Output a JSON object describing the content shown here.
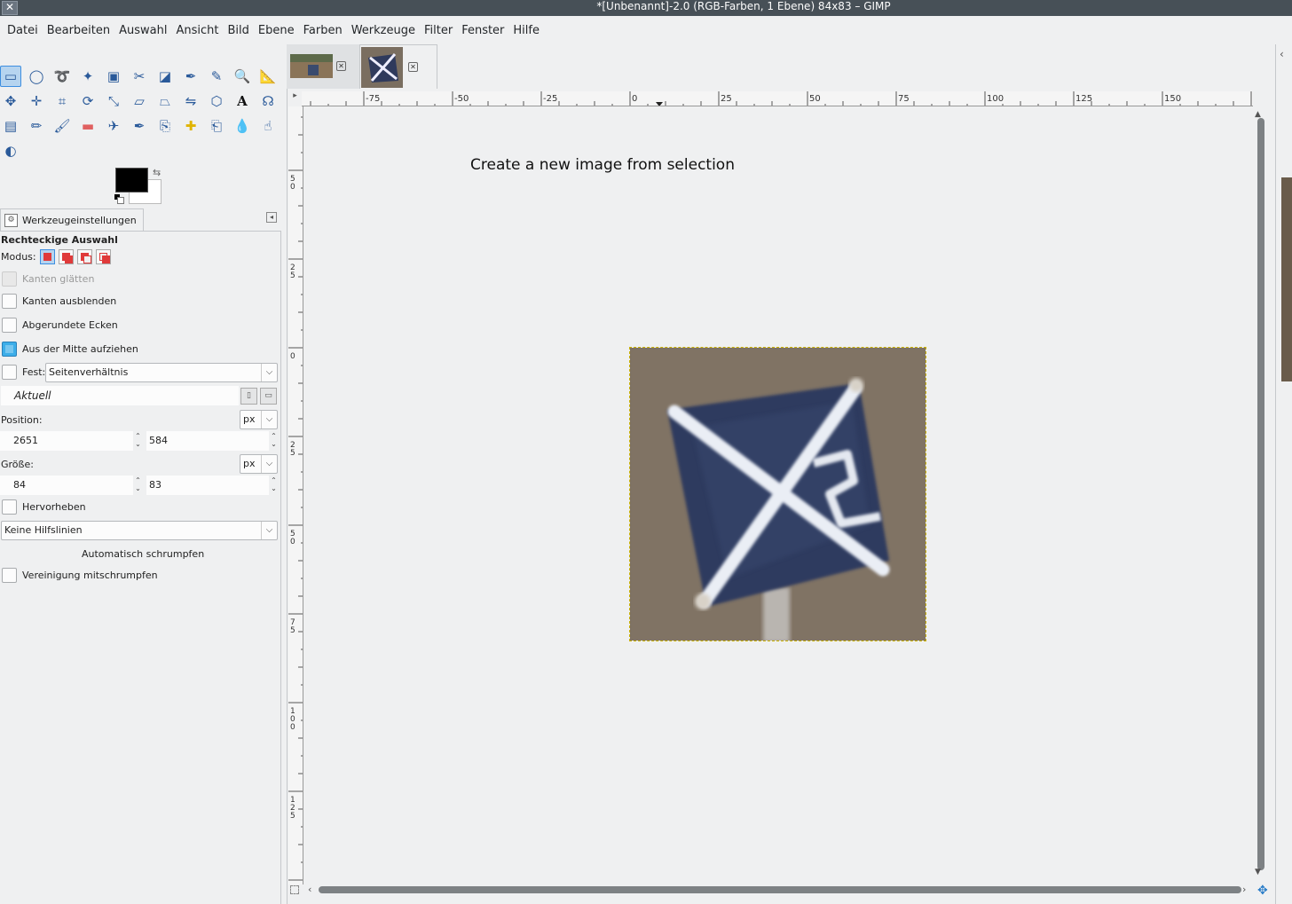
{
  "window": {
    "title": "*[Unbenannt]-2.0 (RGB-Farben, 1 Ebene) 84x83 – GIMP"
  },
  "menubar": {
    "items": [
      "Datei",
      "Bearbeiten",
      "Auswahl",
      "Ansicht",
      "Bild",
      "Ebene",
      "Farben",
      "Werkzeuge",
      "Filter",
      "Fenster",
      "Hilfe"
    ]
  },
  "toolbox": {
    "tools": [
      "rect-select",
      "ellipse-select",
      "free-select",
      "fuzzy-select",
      "select-by-color",
      "scissors-select",
      "foreground-select",
      "paths",
      "color-picker",
      "zoom",
      "measure",
      "move",
      "align",
      "crop",
      "rotate",
      "scale",
      "shear",
      "perspective",
      "flip",
      "cage-transform",
      "text",
      "warp-transform",
      "blend",
      "pencil",
      "paintbrush",
      "eraser",
      "airbrush",
      "ink",
      "clone",
      "heal",
      "perspective-clone",
      "blur",
      "smudge",
      "dodge-burn"
    ],
    "active_tool": "rect-select",
    "foreground_color": "#000000",
    "background_color": "#ffffff"
  },
  "tool_options": {
    "tab_label": "Werkzeugeinstellungen",
    "title": "Rechteckige Auswahl",
    "mode_label": "Modus:",
    "antialias": {
      "label": "Kanten glätten",
      "checked": false,
      "enabled": false
    },
    "feather": {
      "label": "Kanten ausblenden",
      "checked": false
    },
    "rounded": {
      "label": "Abgerundete Ecken",
      "checked": false
    },
    "from_center": {
      "label": "Aus der Mitte aufziehen",
      "checked": true
    },
    "fixed": {
      "label": "Fest:",
      "checked": false,
      "value": "Seitenverhältnis"
    },
    "aspect_value": "Aktuell",
    "position": {
      "label": "Position:",
      "unit": "px",
      "x": "2651",
      "y": "584"
    },
    "size": {
      "label": "Größe:",
      "unit": "px",
      "w": "84",
      "h": "83"
    },
    "highlight": {
      "label": "Hervorheben",
      "checked": false
    },
    "guides": {
      "value": "Keine Hilfslinien"
    },
    "autoshrink_label": "Automatisch schrumpfen",
    "shrink_merged": {
      "label": "Vereinigung mitschrumpfen",
      "checked": false
    }
  },
  "canvas": {
    "instruction": "Create a new image from selection",
    "hruler_labels": [
      "-75",
      "-50",
      "-25",
      "0",
      "25",
      "50",
      "75",
      "100",
      "125",
      "150"
    ],
    "vruler_labels": [
      "50",
      "25",
      "0",
      "25",
      "50",
      "75",
      "100",
      "125"
    ]
  },
  "colors": {
    "accent": "#3daee9",
    "selection_marquee": "#c9b100",
    "image_bg": "#7a6e60",
    "sign_blue": "#2f3a5c"
  }
}
